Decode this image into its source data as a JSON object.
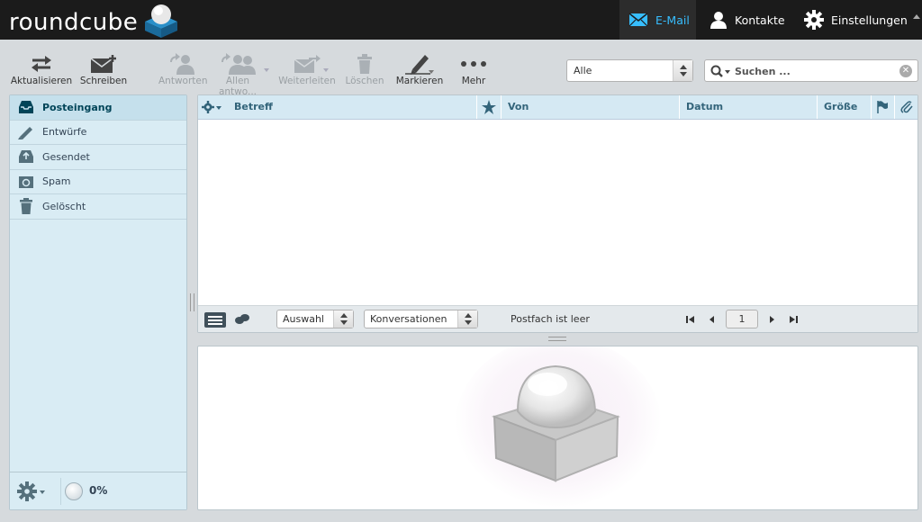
{
  "app": {
    "logo_text": "roundcube"
  },
  "topnav": {
    "mail_label": "E-Mail",
    "contacts_label": "Kontakte",
    "settings_label": "Einstellungen"
  },
  "toolbar": {
    "refresh_label": "Aktualisieren",
    "compose_label": "Schreiben",
    "reply_label": "Antworten",
    "reply_all_label": "Allen antwo...",
    "forward_label": "Weiterleiten",
    "delete_label": "Löschen",
    "mark_label": "Markieren",
    "more_label": "Mehr"
  },
  "filter": {
    "selected": "Alle"
  },
  "search": {
    "placeholder": "Suchen ..."
  },
  "folders": [
    {
      "label": "Posteingang",
      "icon": "inbox-icon",
      "selected": true
    },
    {
      "label": "Entwürfe",
      "icon": "pencil-icon",
      "selected": false
    },
    {
      "label": "Gesendet",
      "icon": "sent-icon",
      "selected": false
    },
    {
      "label": "Spam",
      "icon": "spam-icon",
      "selected": false
    },
    {
      "label": "Gelöscht",
      "icon": "trash-icon",
      "selected": false
    }
  ],
  "quota": {
    "text": "0%"
  },
  "messagelist": {
    "columns": {
      "subject": "Betreff",
      "from": "Von",
      "date": "Datum",
      "size": "Größe"
    },
    "rows": []
  },
  "listfooter": {
    "selection_label": "Auswahl",
    "threads_label": "Konversationen",
    "status": "Postfach ist leer",
    "page": "1"
  },
  "colors": {
    "topbar_bg": "#1b1b1b",
    "accent": "#37beff",
    "folder_bg": "#d9ecf4",
    "list_header_bg": "#d5e9f3"
  }
}
